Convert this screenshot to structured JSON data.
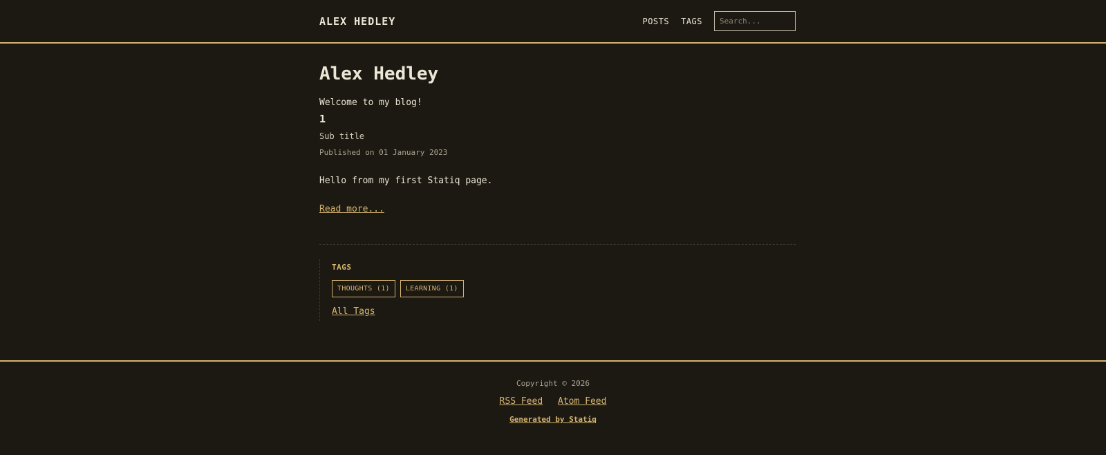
{
  "header": {
    "brand": "ALEX HEDLEY",
    "nav": [
      "POSTS",
      "TAGS"
    ],
    "search_placeholder": "Search..."
  },
  "main": {
    "title": "Alex Hedley",
    "intro": "Welcome to my blog!",
    "post": {
      "title": "1",
      "subtitle": "Sub title",
      "date": "Published on 01 January 2023",
      "excerpt": "Hello from my first Statiq page.",
      "read_more": "Read more..."
    },
    "tags": {
      "heading": "TAGS",
      "items": [
        "THOUGHTS (1)",
        "LEARNING (1)"
      ],
      "all_tags": "All Tags"
    }
  },
  "footer": {
    "copyright": "Copyright © 2026",
    "rss": "RSS Feed",
    "atom": "Atom Feed",
    "generated": "Generated by Statiq"
  },
  "colors": {
    "background": "#1c1912",
    "accent": "#d6b571",
    "text": "#ece6d6"
  }
}
